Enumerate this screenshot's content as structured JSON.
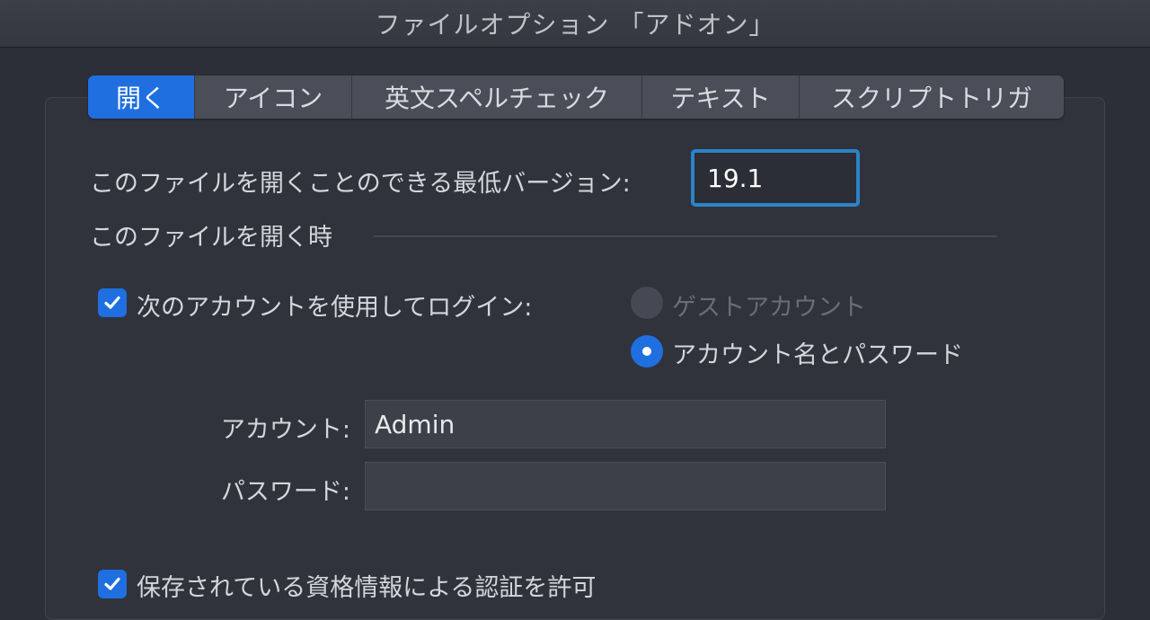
{
  "window": {
    "title": "ファイルオプション 「アドオン」"
  },
  "tabs": [
    {
      "label": "開く",
      "active": true
    },
    {
      "label": "アイコン",
      "active": false
    },
    {
      "label": "英文スペルチェック",
      "active": false
    },
    {
      "label": "テキスト",
      "active": false
    },
    {
      "label": "スクリプトトリガ",
      "active": false
    }
  ],
  "open": {
    "min_version_label": "このファイルを開くことのできる最低バージョン:",
    "min_version_value": "19.1",
    "on_open_heading": "このファイルを開く時",
    "login_checkbox_label": "次のアカウントを使用してログイン:",
    "login_checked": true,
    "radio_guest_label": "ゲストアカウント",
    "radio_account_label": "アカウント名とパスワード",
    "selected_radio": "アカウント名とパスワード",
    "account_label": "アカウント:",
    "account_value": "Admin",
    "password_label": "パスワード:",
    "password_value": "",
    "keychain_checkbox_label": "保存されている資格情報による認証を許可",
    "keychain_checked": true
  },
  "colors": {
    "accent": "#1f6fe0",
    "focus_ring": "#2a83c7",
    "background": "#2c2f38"
  }
}
